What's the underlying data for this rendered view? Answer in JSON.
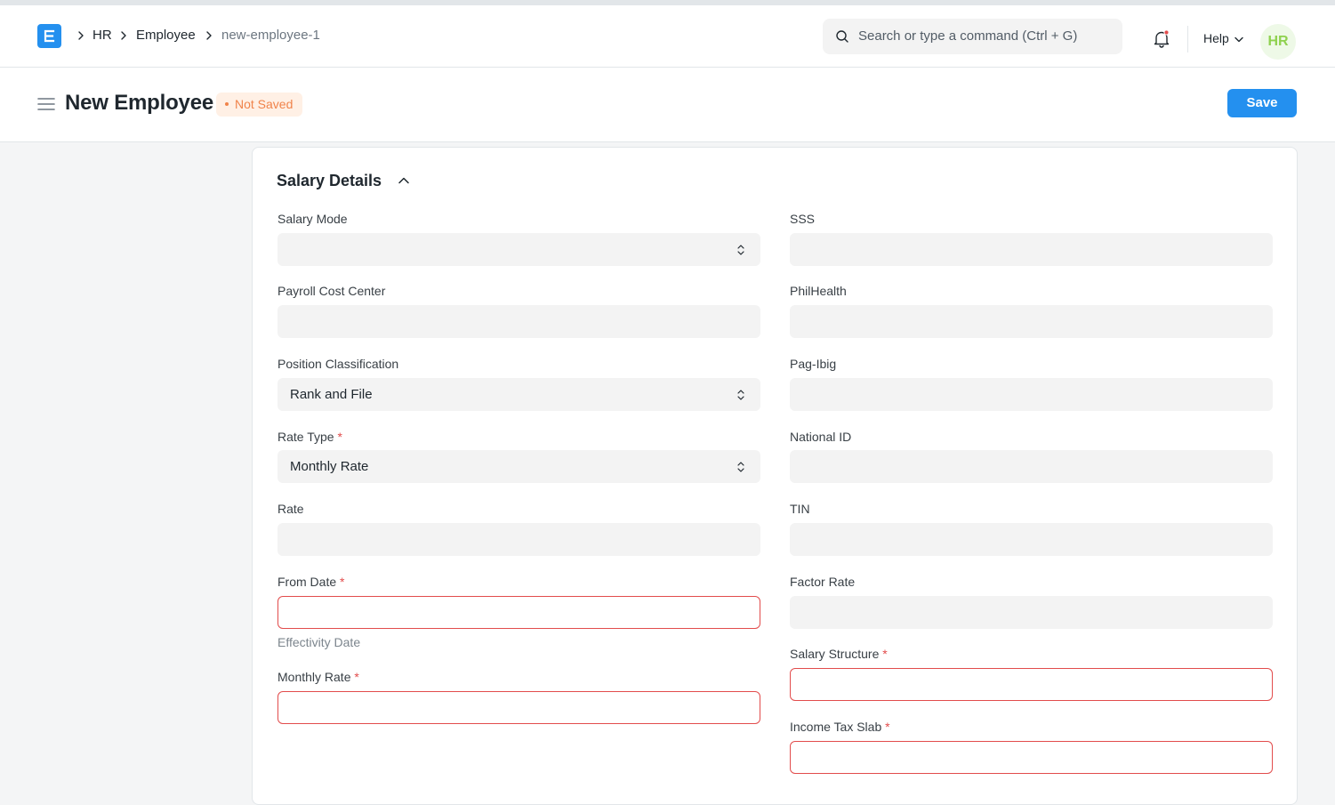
{
  "navbar": {
    "breadcrumbs": [
      "HR",
      "Employee",
      "new-employee-1"
    ],
    "search_placeholder": "Search or type a command (Ctrl + G)",
    "help_label": "Help",
    "avatar_initials": "HR"
  },
  "page": {
    "title": "New Employee",
    "status": "Not Saved",
    "save_label": "Save"
  },
  "section": {
    "title": "Salary Details"
  },
  "fields": {
    "salary_mode": {
      "label": "Salary Mode",
      "value": ""
    },
    "payroll_cost_center": {
      "label": "Payroll Cost Center",
      "value": ""
    },
    "position_classification": {
      "label": "Position Classification",
      "value": "Rank and File"
    },
    "rate_type": {
      "label": "Rate Type",
      "value": "Monthly Rate",
      "required": "*"
    },
    "rate": {
      "label": "Rate",
      "value": ""
    },
    "from_date": {
      "label": "From Date",
      "value": "",
      "required": "*",
      "description": "Effectivity Date"
    },
    "monthly_rate": {
      "label": "Monthly Rate",
      "value": "",
      "required": "*"
    },
    "sss": {
      "label": "SSS",
      "value": ""
    },
    "philhealth": {
      "label": "PhilHealth",
      "value": ""
    },
    "pag_ibig": {
      "label": "Pag-Ibig",
      "value": ""
    },
    "national_id": {
      "label": "National ID",
      "value": ""
    },
    "tin": {
      "label": "TIN",
      "value": ""
    },
    "factor_rate": {
      "label": "Factor Rate",
      "value": ""
    },
    "salary_structure": {
      "label": "Salary Structure",
      "value": "",
      "required": "*"
    },
    "income_tax_slab": {
      "label": "Income Tax Slab",
      "value": "",
      "required": "*"
    }
  },
  "colors": {
    "primary": "#2490ef",
    "required": "#e24c4c",
    "status_text": "#f0834a",
    "status_bg": "#fff0e5",
    "avatar_text": "#8fd14f"
  }
}
